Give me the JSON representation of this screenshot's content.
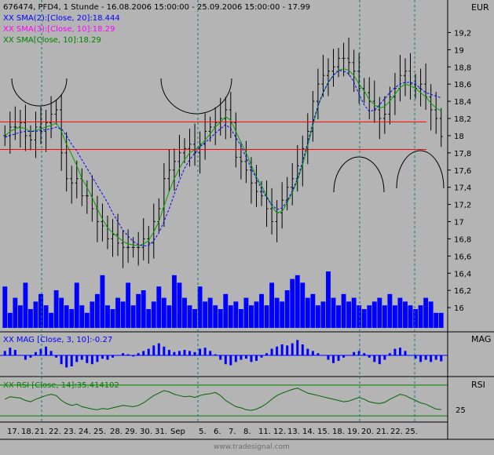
{
  "header": {
    "title": "676474, PFD4, 1 Stunde - 16.08.2006 15:00:00 - 25.09.2006 15:00:00 - 17.99",
    "currency": "EUR"
  },
  "legends": [
    {
      "text": "XX SMA(2):[Close, 20]:18.444",
      "color": "#0000ff"
    },
    {
      "text": "XX SMA(3):[Close, 10]:18.29",
      "color": "#ff00ff"
    },
    {
      "text": "XX SMA[Close, 10]:18.29",
      "color": "#008000"
    }
  ],
  "mag_panel": {
    "legend": "XX MAG [Close, 3, 10]:-0.27",
    "axis_label": "MAG"
  },
  "rsi_panel": {
    "legend": "XX RSI [Close, 14]:35.414102",
    "axis_label": "RSI",
    "tick_label": "25"
  },
  "xaxis_labels": [
    "17.",
    "18.",
    "21.",
    "22.",
    "23.",
    "24.",
    "25.",
    "28.",
    "29.",
    "30.",
    "31.",
    "Sep",
    "5.",
    "6.",
    "7.",
    "8.",
    "11.",
    "12.",
    "13.",
    "14.",
    "15.",
    "18.",
    "19.",
    "20.",
    "21.",
    "22.",
    "25."
  ],
  "watermark": "www.tradesignal.com",
  "colors": {
    "background": "#b4b4b4",
    "price": "#000000",
    "sma20": "#0000ff",
    "sma10": "#00a000",
    "volume": "#0000ff",
    "support": "#ff0000",
    "arcs": "#000000",
    "separator": "#008080"
  },
  "chart_data": [
    {
      "type": "line",
      "series_kind": "ohlc",
      "ylim": [
        15.8,
        19.35
      ],
      "y_ticks": [
        "16",
        "16,2",
        "16,4",
        "16,6",
        "16,8",
        "17",
        "17,2",
        "17,4",
        "17,6",
        "17,8",
        "18",
        "18,2",
        "18,4",
        "18,6",
        "18,8",
        "19",
        "19,2"
      ],
      "closes": [
        18.0,
        18.1,
        18.1,
        18.15,
        18.0,
        17.95,
        18.1,
        18.05,
        18.15,
        18.25,
        18.3,
        17.8,
        17.5,
        17.45,
        17.5,
        17.3,
        17.3,
        17.15,
        17.0,
        16.95,
        16.8,
        16.85,
        16.75,
        16.7,
        16.7,
        16.7,
        16.7,
        16.8,
        16.75,
        17.0,
        17.15,
        17.5,
        17.6,
        17.7,
        17.8,
        17.85,
        17.9,
        17.8,
        17.9,
        18.05,
        18.1,
        18.15,
        18.2,
        18.3,
        18.15,
        17.75,
        17.7,
        17.6,
        17.45,
        17.35,
        17.3,
        17.15,
        17.0,
        17.1,
        17.25,
        17.4,
        17.5,
        17.65,
        17.85,
        18.05,
        18.4,
        18.6,
        18.7,
        18.75,
        18.8,
        18.9,
        18.9,
        18.85,
        18.75,
        18.55,
        18.5,
        18.4,
        18.3,
        18.2,
        18.25,
        18.45,
        18.55,
        18.7,
        18.75,
        18.6,
        18.55,
        18.6,
        18.45,
        18.3,
        18.2,
        17.99
      ],
      "sma20": [
        17.98,
        18.0,
        18.02,
        18.04,
        18.05,
        18.05,
        18.05,
        18.06,
        18.07,
        18.08,
        18.1,
        18.08,
        18.0,
        17.9,
        17.82,
        17.72,
        17.62,
        17.52,
        17.42,
        17.32,
        17.22,
        17.1,
        17.0,
        16.9,
        16.83,
        16.77,
        16.73,
        16.72,
        16.72,
        16.78,
        16.87,
        17.0,
        17.15,
        17.32,
        17.48,
        17.62,
        17.72,
        17.8,
        17.87,
        17.92,
        17.97,
        18.03,
        18.08,
        18.13,
        18.08,
        17.98,
        17.88,
        17.75,
        17.62,
        17.5,
        17.38,
        17.28,
        17.2,
        17.14,
        17.16,
        17.24,
        17.36,
        17.5,
        17.7,
        17.92,
        18.15,
        18.35,
        18.5,
        18.62,
        18.7,
        18.76,
        18.75,
        18.72,
        18.62,
        18.48,
        18.36,
        18.28,
        18.3,
        18.36,
        18.43,
        18.5,
        18.56,
        18.6,
        18.62,
        18.62,
        18.6,
        18.55,
        18.5,
        18.48,
        18.46,
        18.44
      ],
      "sma10": [
        18.0,
        18.05,
        18.08,
        18.1,
        18.08,
        18.05,
        18.06,
        18.08,
        18.1,
        18.12,
        18.15,
        18.05,
        17.9,
        17.78,
        17.65,
        17.5,
        17.4,
        17.28,
        17.15,
        17.03,
        16.93,
        16.87,
        16.82,
        16.77,
        16.74,
        16.73,
        16.72,
        16.74,
        16.78,
        16.88,
        17.0,
        17.18,
        17.35,
        17.5,
        17.62,
        17.72,
        17.8,
        17.84,
        17.88,
        17.95,
        18.02,
        18.1,
        18.16,
        18.22,
        18.18,
        18.05,
        17.92,
        17.8,
        17.66,
        17.52,
        17.42,
        17.3,
        17.18,
        17.1,
        17.12,
        17.22,
        17.34,
        17.48,
        17.66,
        17.88,
        18.12,
        18.34,
        18.5,
        18.62,
        18.7,
        18.76,
        18.78,
        18.76,
        18.7,
        18.6,
        18.52,
        18.42,
        18.36,
        18.32,
        18.34,
        18.4,
        18.48,
        18.56,
        18.6,
        18.58,
        18.55,
        18.5,
        18.45,
        18.38,
        18.32,
        18.29
      ],
      "support_levels": [
        18.16,
        17.84
      ]
    },
    {
      "type": "bar",
      "title": "",
      "values": [
        55,
        20,
        40,
        30,
        60,
        25,
        35,
        45,
        30,
        20,
        50,
        40,
        30,
        25,
        60,
        30,
        20,
        35,
        45,
        70,
        30,
        25,
        40,
        35,
        60,
        30,
        45,
        50,
        25,
        35,
        55,
        40,
        30,
        70,
        60,
        40,
        30,
        25,
        55,
        35,
        40,
        30,
        25,
        45,
        30,
        35,
        25,
        40,
        30,
        35,
        45,
        30,
        60,
        40,
        35,
        50,
        65,
        70,
        60,
        40,
        45,
        30,
        35,
        75,
        40,
        30,
        45,
        35,
        40,
        30,
        25,
        30,
        35,
        40,
        30,
        45,
        30,
        40,
        35,
        30,
        25,
        30,
        40,
        35,
        20,
        20
      ]
    },
    {
      "type": "line",
      "title": "MAG",
      "values": [
        0.2,
        0.35,
        0.25,
        0.0,
        -0.2,
        -0.1,
        0.15,
        0.3,
        0.4,
        0.2,
        -0.1,
        -0.4,
        -0.55,
        -0.5,
        -0.3,
        -0.2,
        -0.35,
        -0.4,
        -0.3,
        -0.15,
        -0.2,
        -0.1,
        0.0,
        0.1,
        0.05,
        -0.05,
        0.1,
        0.2,
        0.3,
        0.45,
        0.55,
        0.4,
        0.25,
        0.15,
        0.2,
        0.25,
        0.2,
        0.15,
        0.3,
        0.35,
        0.2,
        0.05,
        -0.2,
        -0.4,
        -0.45,
        -0.3,
        -0.2,
        -0.15,
        -0.3,
        -0.25,
        -0.1,
        0.1,
        0.3,
        0.4,
        0.5,
        0.45,
        0.55,
        0.7,
        0.5,
        0.3,
        0.2,
        0.1,
        0.0,
        -0.2,
        -0.35,
        -0.25,
        -0.1,
        0.0,
        0.15,
        0.2,
        0.1,
        -0.1,
        -0.3,
        -0.4,
        -0.2,
        0.1,
        0.3,
        0.35,
        0.2,
        0.0,
        -0.15,
        -0.3,
        -0.2,
        -0.3,
        -0.2,
        -0.27
      ]
    },
    {
      "type": "line",
      "title": "RSI",
      "values": [
        52,
        56,
        55,
        54,
        50,
        48,
        52,
        55,
        58,
        60,
        58,
        50,
        45,
        42,
        44,
        40,
        38,
        36,
        35,
        37,
        36,
        38,
        40,
        42,
        41,
        40,
        42,
        46,
        52,
        58,
        62,
        66,
        64,
        60,
        58,
        56,
        57,
        55,
        58,
        60,
        61,
        63,
        58,
        50,
        45,
        40,
        38,
        35,
        34,
        36,
        40,
        45,
        52,
        58,
        62,
        65,
        68,
        70,
        66,
        62,
        60,
        58,
        56,
        54,
        52,
        50,
        48,
        49,
        52,
        55,
        52,
        48,
        46,
        45,
        47,
        52,
        56,
        60,
        58,
        54,
        50,
        46,
        44,
        40,
        36,
        35.4
      ],
      "ref_lines": [
        75,
        25
      ],
      "ylim": [
        15,
        85
      ]
    }
  ]
}
